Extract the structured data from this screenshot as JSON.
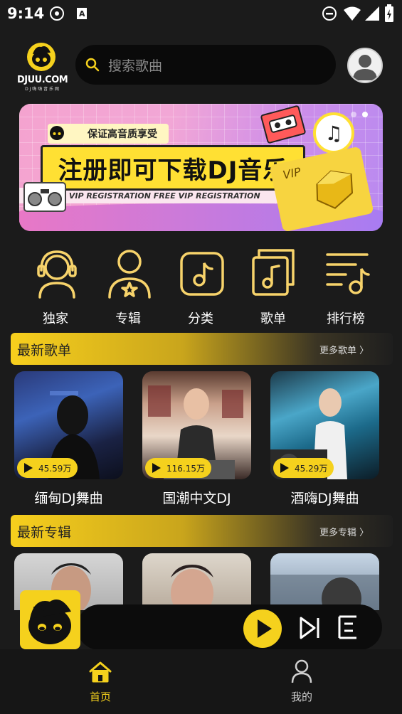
{
  "status_bar": {
    "time": "9:14"
  },
  "header": {
    "logo_text": "DJUU.COM",
    "logo_subtext": "D J 嗨 嗨 音 乐 网",
    "search_placeholder": "搜索歌曲"
  },
  "banner": {
    "tag": "保证高音质享受",
    "title": "注册即可下载DJ音乐",
    "strip_text": "FREE VIP REGISTRATION    FREE VIP REGISTRATION",
    "vip_label": "VIP"
  },
  "categories": [
    {
      "label": "独家",
      "icon": "headphones-person-icon"
    },
    {
      "label": "专辑",
      "icon": "person-star-icon"
    },
    {
      "label": "分类",
      "icon": "music-note-square-icon"
    },
    {
      "label": "歌单",
      "icon": "music-playlist-icon"
    },
    {
      "label": "排行榜",
      "icon": "ranking-list-icon"
    }
  ],
  "sections": {
    "playlists": {
      "title": "最新歌单",
      "more": "更多歌单 〉"
    },
    "albums": {
      "title": "最新专辑",
      "more": "更多专辑 〉"
    }
  },
  "playlists": [
    {
      "name": "缅甸DJ舞曲",
      "plays": "45.59万"
    },
    {
      "name": "国潮中文DJ",
      "plays": "116.15万"
    },
    {
      "name": "酒嗨DJ舞曲",
      "plays": "45.29万"
    }
  ],
  "tabs": [
    {
      "label": "首页",
      "icon": "home-icon",
      "active": true
    },
    {
      "label": "我的",
      "icon": "user-icon",
      "active": false
    }
  ],
  "colors": {
    "accent": "#f5d11d",
    "background": "#1b1b1b",
    "tab_active": "#f5d11d",
    "tab_inactive": "#cfcfcf"
  }
}
